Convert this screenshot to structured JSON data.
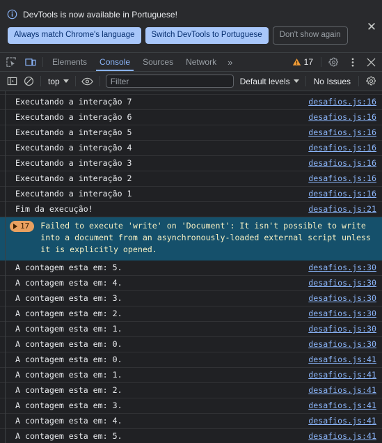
{
  "banner": {
    "icon": "info-circle-icon",
    "message": "DevTools is now available in Portuguese!",
    "primary_button_1": "Always match Chrome's language",
    "primary_button_2": "Switch DevTools to Portuguese",
    "dismiss_button": "Don't show again",
    "close_icon": "✕",
    "accent": "#a8c7fa",
    "text_on_accent": "#062e6f"
  },
  "tabbar": {
    "inspect_icon": "inspect-element-icon",
    "device_icon": "device-toolbar-icon",
    "tabs": [
      {
        "label": "Elements",
        "active": false
      },
      {
        "label": "Console",
        "active": true
      },
      {
        "label": "Sources",
        "active": false
      },
      {
        "label": "Network",
        "active": false
      }
    ],
    "more_tabs": "»",
    "warning_count": "17",
    "warning_icon": "warning-triangle-icon",
    "settings_icon": "gear-icon",
    "menu_icon": "kebab-menu-icon",
    "close_icon": "✕",
    "active_color": "#8ab4f8",
    "warning_color": "#f29d38"
  },
  "filterbar": {
    "sidebar_icon": "console-sidebar-icon",
    "clear_icon": "clear-console-icon",
    "context": "top",
    "eye_icon": "live-expression-icon",
    "filter_placeholder": "Filter",
    "filter_value": "",
    "levels": "Default levels",
    "issues": "No Issues",
    "settings_icon": "console-settings-gear-icon"
  },
  "console": {
    "rows": [
      {
        "kind": "clipped",
        "message": "",
        "source": ""
      },
      {
        "kind": "log",
        "message": "Executando a interação 7",
        "source": "desafios.js:16"
      },
      {
        "kind": "log",
        "message": "Executando a interação 6",
        "source": "desafios.js:16"
      },
      {
        "kind": "log",
        "message": "Executando a interação 5",
        "source": "desafios.js:16"
      },
      {
        "kind": "log",
        "message": "Executando a interação 4",
        "source": "desafios.js:16"
      },
      {
        "kind": "log",
        "message": "Executando a interação 3",
        "source": "desafios.js:16"
      },
      {
        "kind": "log",
        "message": "Executando a interação 2",
        "source": "desafios.js:16"
      },
      {
        "kind": "log",
        "message": "Executando a interação 1",
        "source": "desafios.js:16"
      },
      {
        "kind": "log",
        "message": "Fim da execução!",
        "source": "desafios.js:21"
      },
      {
        "kind": "error",
        "badge": "17",
        "message": "Failed to execute 'write' on 'Document': It isn't possible to write into a document from an asynchronously-loaded external script unless it is explicitly opened.",
        "source": ""
      },
      {
        "kind": "log",
        "message": "A contagem esta em: 5.",
        "source": "desafios.js:30"
      },
      {
        "kind": "log",
        "message": "A contagem esta em: 4.",
        "source": "desafios.js:30"
      },
      {
        "kind": "log",
        "message": "A contagem esta em: 3.",
        "source": "desafios.js:30"
      },
      {
        "kind": "log",
        "message": "A contagem esta em: 2.",
        "source": "desafios.js:30"
      },
      {
        "kind": "log",
        "message": "A contagem esta em: 1.",
        "source": "desafios.js:30"
      },
      {
        "kind": "log",
        "message": "A contagem esta em: 0.",
        "source": "desafios.js:30"
      },
      {
        "kind": "log",
        "message": "A contagem esta em: 0.",
        "source": "desafios.js:41"
      },
      {
        "kind": "log",
        "message": "A contagem esta em: 1.",
        "source": "desafios.js:41"
      },
      {
        "kind": "log",
        "message": "A contagem esta em: 2.",
        "source": "desafios.js:41"
      },
      {
        "kind": "log",
        "message": "A contagem esta em: 3.",
        "source": "desafios.js:41"
      },
      {
        "kind": "log",
        "message": "A contagem esta em: 4.",
        "source": "desafios.js:41"
      },
      {
        "kind": "log",
        "message": "A contagem esta em: 5.",
        "source": "desafios.js:41"
      }
    ],
    "link_color": "#8ab4f8",
    "error_bg": "#15506b",
    "error_text": "#f5efc3",
    "badge_bg": "#e8a060"
  }
}
